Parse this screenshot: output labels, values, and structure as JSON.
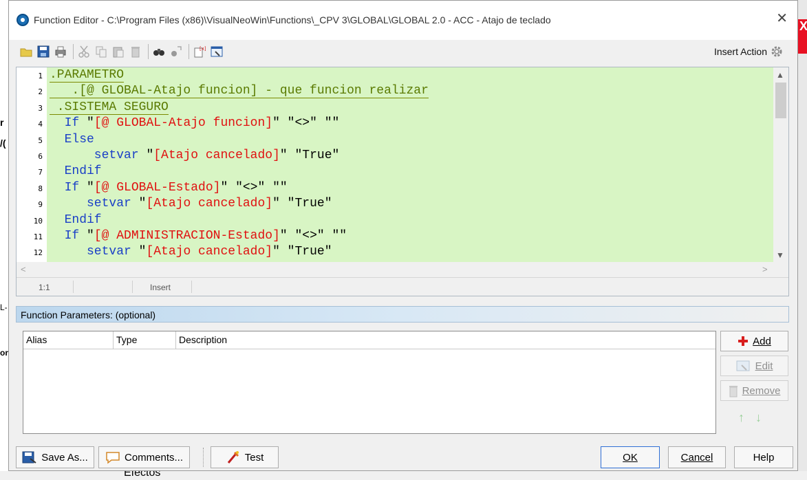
{
  "window": {
    "title": "Function Editor - C:\\Program Files (x86)\\VisualNeoWin\\Functions\\_CPV 3\\GLOBAL\\GLOBAL 2.0 - ACC - Atajo de teclado",
    "close_label": "✕"
  },
  "toolbar": {
    "insert_action_label": "Insert Action"
  },
  "editor": {
    "lines": [
      {
        "n": "1",
        "parts": [
          {
            "t": ".PARAMETRO",
            "c": "label"
          }
        ]
      },
      {
        "n": "2",
        "parts": [
          {
            "t": "   .[@ GLOBAL-Atajo funcion] - que funcion realizar",
            "c": "label"
          }
        ]
      },
      {
        "n": "3",
        "parts": [
          {
            "t": " .SISTEMA SEGURO",
            "c": "label"
          }
        ]
      },
      {
        "n": "4",
        "parts": [
          {
            "t": "  If ",
            "c": "kw"
          },
          {
            "t": "\"",
            "c": "quote"
          },
          {
            "t": "[@ GLOBAL-Atajo funcion]",
            "c": "str"
          },
          {
            "t": "\" \"<>\" \"\"",
            "c": "quote"
          }
        ]
      },
      {
        "n": "5",
        "parts": [
          {
            "t": "  Else",
            "c": "kw"
          }
        ]
      },
      {
        "n": "6",
        "parts": [
          {
            "t": "      setvar ",
            "c": "kw"
          },
          {
            "t": "\"",
            "c": "quote"
          },
          {
            "t": "[Atajo cancelado]",
            "c": "str"
          },
          {
            "t": "\" \"True\"",
            "c": "quote"
          }
        ]
      },
      {
        "n": "7",
        "parts": [
          {
            "t": "  Endif",
            "c": "kw"
          }
        ]
      },
      {
        "n": "8",
        "parts": [
          {
            "t": "  If ",
            "c": "kw"
          },
          {
            "t": "\"",
            "c": "quote"
          },
          {
            "t": "[@ GLOBAL-Estado]",
            "c": "str"
          },
          {
            "t": "\" \"<>\" \"\"",
            "c": "quote"
          }
        ]
      },
      {
        "n": "9",
        "parts": [
          {
            "t": "     setvar ",
            "c": "kw"
          },
          {
            "t": "\"",
            "c": "quote"
          },
          {
            "t": "[Atajo cancelado]",
            "c": "str"
          },
          {
            "t": "\" \"True\"",
            "c": "quote"
          }
        ]
      },
      {
        "n": "10",
        "parts": [
          {
            "t": "  Endif",
            "c": "kw"
          }
        ]
      },
      {
        "n": "11",
        "parts": [
          {
            "t": "  If ",
            "c": "kw"
          },
          {
            "t": "\"",
            "c": "quote"
          },
          {
            "t": "[@ ADMINISTRACION-Estado]",
            "c": "str"
          },
          {
            "t": "\" \"<>\" \"\"",
            "c": "quote"
          }
        ]
      },
      {
        "n": "12",
        "parts": [
          {
            "t": "     setvar ",
            "c": "kw"
          },
          {
            "t": "\"",
            "c": "quote"
          },
          {
            "t": "[Atajo cancelado]",
            "c": "str"
          },
          {
            "t": "\" \"True\"",
            "c": "quote"
          }
        ]
      }
    ],
    "status": {
      "position": "1:1",
      "mode": "Insert"
    }
  },
  "params": {
    "header": "Function Parameters: (optional)",
    "columns": [
      "Alias",
      "Type",
      "Description"
    ],
    "add_label": "Add",
    "edit_label": "Edit",
    "remove_label": "Remove"
  },
  "buttons": {
    "save_as": "Save As...",
    "comments": "Comments...",
    "test": "Test",
    "ok": "OK",
    "cancel": "Cancel",
    "help": "Help"
  },
  "colors": {
    "code_bg": "#d8f5c4",
    "label": "#5a7a00",
    "keyword": "#1a3fc7",
    "string": "#e01010"
  }
}
